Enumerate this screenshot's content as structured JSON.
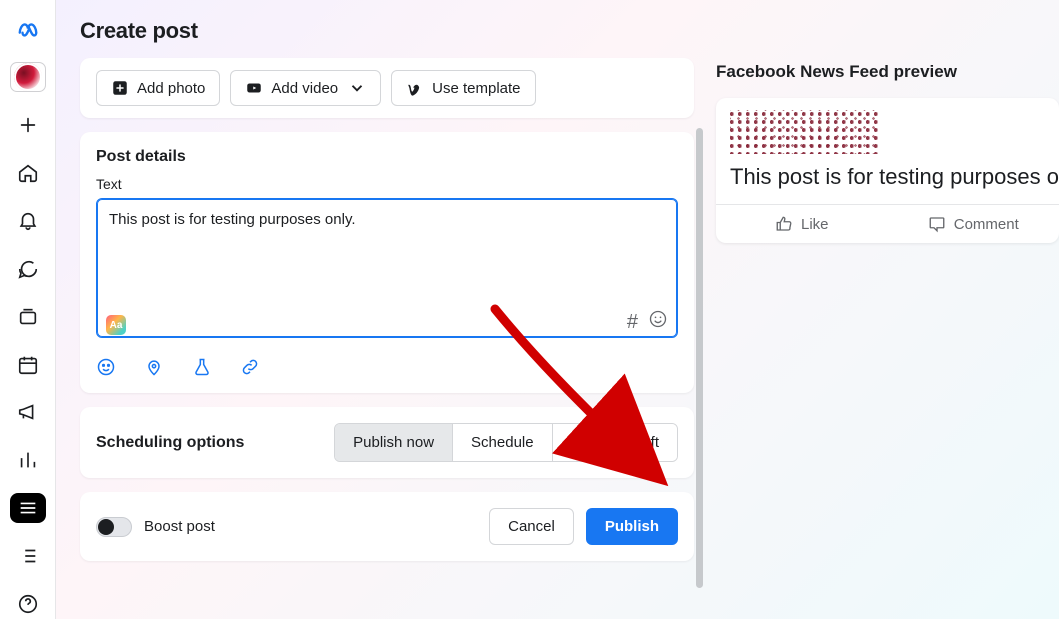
{
  "page_title": "Create post",
  "media": {
    "add_photo": "Add photo",
    "add_video": "Add video",
    "use_template": "Use template"
  },
  "post_details": {
    "section_title": "Post details",
    "text_label": "Text",
    "text_value": "This post is for testing purposes only.",
    "aa_badge": "Aa",
    "hash": "#",
    "tools": {
      "emoji": "emoji-icon",
      "location": "location-icon",
      "beaker": "beaker-icon",
      "link": "link-icon"
    }
  },
  "scheduling": {
    "section_title": "Scheduling options",
    "publish_now": "Publish now",
    "schedule": "Schedule",
    "save_draft": "Save as draft",
    "selected": "publish_now"
  },
  "footer": {
    "boost_label": "Boost post",
    "cancel": "Cancel",
    "publish": "Publish"
  },
  "preview": {
    "title": "Facebook News Feed preview",
    "post_text": "This post is for testing purposes o",
    "like": "Like",
    "comment": "Comment"
  }
}
